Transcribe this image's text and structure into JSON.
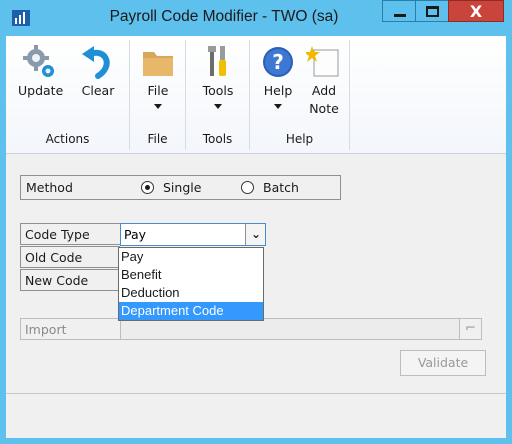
{
  "window": {
    "title": "Payroll Code Modifier  -  TWO (sa)",
    "close_label": "X",
    "accent_color": "#5ec0ec",
    "close_color": "#c9443a"
  },
  "ribbon": {
    "groups": [
      {
        "label": "Actions",
        "buttons": [
          {
            "label": "Update",
            "icon": "gears-icon"
          },
          {
            "label": "Clear",
            "icon": "undo-arrow-icon"
          }
        ]
      },
      {
        "label": "File",
        "buttons": [
          {
            "label": "File",
            "icon": "folder-icon"
          }
        ]
      },
      {
        "label": "Tools",
        "buttons": [
          {
            "label": "Tools",
            "icon": "tools-icon"
          }
        ]
      },
      {
        "label": "Help",
        "buttons": [
          {
            "label": "Help",
            "icon": "help-icon"
          },
          {
            "label": "Add",
            "label2": "Note",
            "icon": "note-icon"
          }
        ]
      }
    ]
  },
  "form": {
    "method": {
      "label": "Method",
      "options": [
        {
          "label": "Single",
          "checked": true
        },
        {
          "label": "Batch",
          "checked": false
        }
      ]
    },
    "code_type": {
      "label": "Code Type",
      "value": "Pay",
      "options": [
        "Pay",
        "Benefit",
        "Deduction",
        "Department Code"
      ],
      "highlighted": "Department Code"
    },
    "old_code": {
      "label": "Old Code"
    },
    "new_code": {
      "label": "New Code"
    },
    "import": {
      "label": "Import"
    },
    "validate_label": "Validate"
  }
}
